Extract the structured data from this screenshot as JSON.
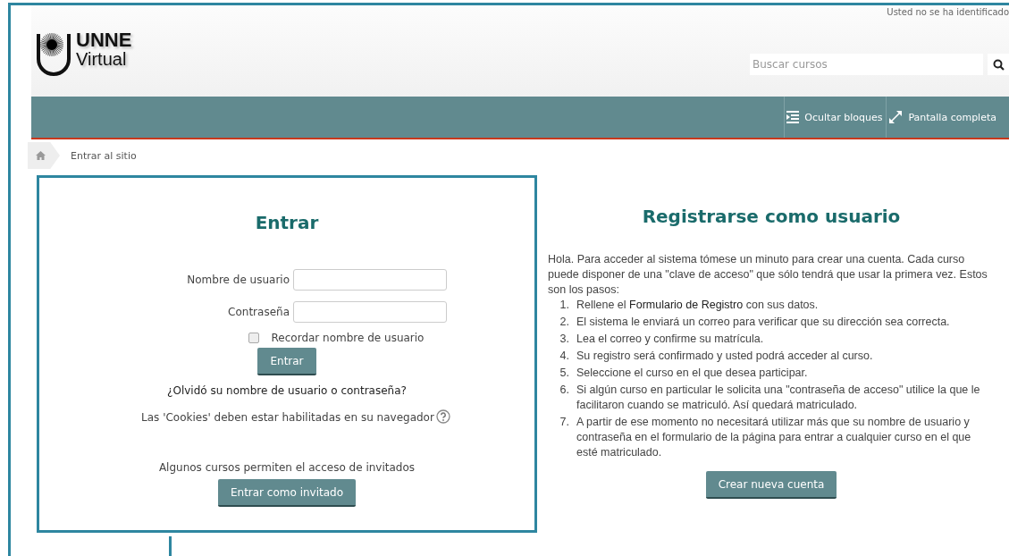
{
  "header": {
    "user_status": "Usted no se ha identificado",
    "logo": {
      "line1": "UNNE",
      "line2": "Virtual"
    },
    "search": {
      "placeholder": "Buscar cursos"
    }
  },
  "navbar": {
    "actions": [
      {
        "label": "Ocultar bloques",
        "kind": "hide-blocks"
      },
      {
        "label": "Pantalla completa",
        "kind": "fullscreen"
      }
    ]
  },
  "breadcrumb": [
    "Entrar al sitio"
  ],
  "login": {
    "title": "Entrar",
    "fields": [
      {
        "label": "Nombre de usuario"
      },
      {
        "label": "Contraseña"
      }
    ],
    "remember": {
      "label": "Recordar nombre de usuario",
      "checked": false
    },
    "submit": "Entrar",
    "forgot": "¿Olvidó su nombre de usuario o contraseña?",
    "cookies": "Las 'Cookies' deben estar habilitadas en su navegador",
    "guest_note": "Algunos cursos permiten el acceso de invitados",
    "guest_button": "Entrar como invitado"
  },
  "signup": {
    "title": "Registrarse como usuario",
    "intro": "Hola. Para acceder al sistema tómese un minuto para crear una cuenta. Cada curso puede disponer de una \"clave de acceso\" que sólo tendrá que usar la primera vez. Estos son los pasos:",
    "steps": [
      {
        "number": "1.",
        "text": "Rellene el ",
        "link": "Formulario de Registro",
        "after": " con sus datos."
      },
      {
        "number": "2.",
        "text": "El sistema le enviará un correo para verificar que su dirección sea correcta."
      },
      {
        "number": "3.",
        "text": "Lea el correo y confirme su matrícula."
      },
      {
        "number": "4.",
        "text": "Su registro será confirmado y usted podrá acceder al curso."
      },
      {
        "number": "5.",
        "text": "Seleccione el curso en el que desea participar."
      },
      {
        "number": "6.",
        "text": "Si algún curso en particular le solicita una \"contraseña de acceso\" utilice la que le facilitaron cuando se matriculó. Así quedará matriculado."
      },
      {
        "number": "7.",
        "text": "A partir de ese momento no necesitará utilizar más que su nombre de usuario y contraseña en el formulario de la página para entrar a cualquier curso en el que esté matriculado."
      }
    ],
    "button": "Crear nueva cuenta"
  }
}
